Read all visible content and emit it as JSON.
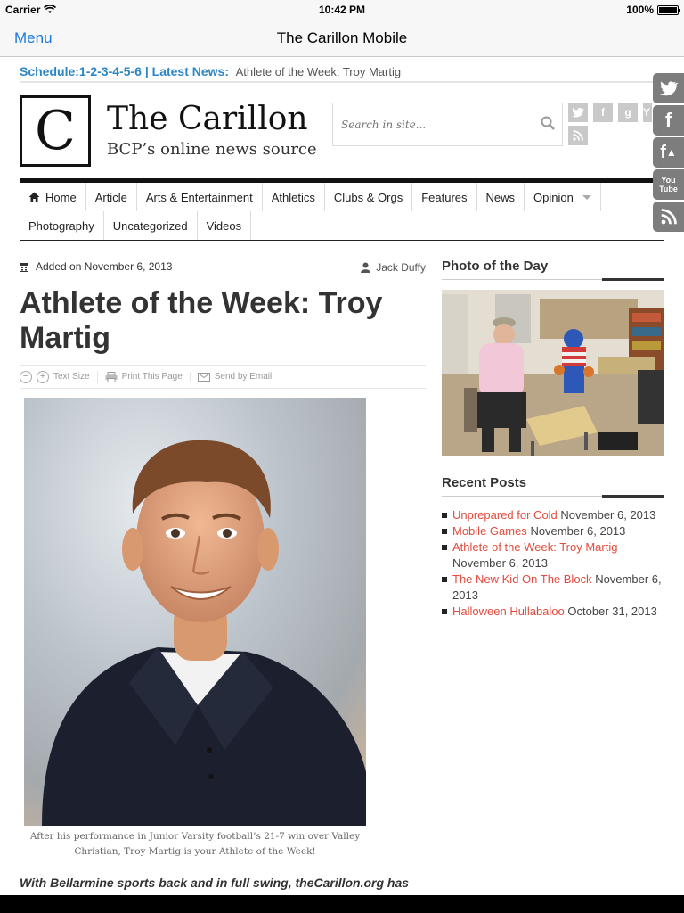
{
  "status": {
    "carrier": "Carrier",
    "time": "10:42 PM",
    "battery": "100%"
  },
  "navbar": {
    "menu_label": "Menu",
    "title": "The Carillon Mobile"
  },
  "ticker": {
    "schedule": "Schedule:1-2-3-4-5-6",
    "separator": " | ",
    "latest_label": "Latest News:",
    "latest_item": "Athlete of the Week: Troy Martig"
  },
  "header": {
    "logo_letter": "C",
    "site_name": "The Carillon",
    "tagline": "BCP’s online news source",
    "search_placeholder": "Search in site..."
  },
  "main_menu": [
    {
      "label": "Home"
    },
    {
      "label": "Article"
    },
    {
      "label": "Arts & Entertainment"
    },
    {
      "label": "Athletics"
    },
    {
      "label": "Clubs & Orgs"
    },
    {
      "label": "Features"
    },
    {
      "label": "News"
    },
    {
      "label": "Opinion"
    },
    {
      "label": "Photography"
    },
    {
      "label": "Uncategorized"
    },
    {
      "label": "Videos"
    }
  ],
  "article": {
    "date": "Added on November 6, 2013",
    "author": "Jack Duffy",
    "title": "Athlete of the Week: Troy Martig",
    "tools": {
      "text_size": "Text Size",
      "print": "Print This Page",
      "email": "Send by Email"
    },
    "caption": "After his performance in Junior Varsity football’s 21-7 win over Valley Christian, Troy Martig is your Athlete of the Week!",
    "lead": "With Bellarmine sports back and in full swing, theCarillon.org has"
  },
  "sidebar": {
    "photo_title": "Photo of the Day",
    "recent_title": "Recent Posts",
    "recent_posts": [
      {
        "title": "Unprepared for Cold",
        "date": "November 6, 2013"
      },
      {
        "title": "Mobile Games",
        "date": "November 6, 2013"
      },
      {
        "title": "Athlete of the Week: Troy Martig",
        "date": "November 6, 2013"
      },
      {
        "title": "The New Kid On The Block",
        "date": "November 6, 2013"
      },
      {
        "title": "Halloween Hullabaloo",
        "date": "October 31, 2013"
      }
    ]
  },
  "share": {
    "twitter": "t",
    "facebook": "f",
    "facebook_like": "f",
    "youtube": "You Tube",
    "rss": ""
  },
  "colors": {
    "link": "#e24c3f",
    "ticker": "#2c86c6",
    "ios_blue": "#1a7ae0"
  }
}
